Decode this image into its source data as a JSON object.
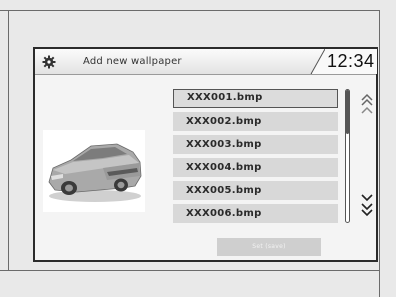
{
  "header": {
    "title": "Add new wallpaper",
    "clock": "12:34",
    "settings_icon": "gear-icon"
  },
  "preview": {
    "icon": "car-image"
  },
  "files": [
    {
      "name": "XXX001.bmp",
      "selected": true
    },
    {
      "name": "XXX002.bmp",
      "selected": false
    },
    {
      "name": "XXX003.bmp",
      "selected": false
    },
    {
      "name": "XXX004.bmp",
      "selected": false
    },
    {
      "name": "XXX005.bmp",
      "selected": false
    },
    {
      "name": "XXX006.bmp",
      "selected": false
    }
  ],
  "scroll": {
    "up_icon": "double-chevron-up-icon",
    "down_icon": "double-chevron-down-icon",
    "position": 0.0
  },
  "actions": {
    "set_label": "Set (save)"
  },
  "colors": {
    "list_item": "#d8d8d8",
    "selected_border": "#555555"
  }
}
